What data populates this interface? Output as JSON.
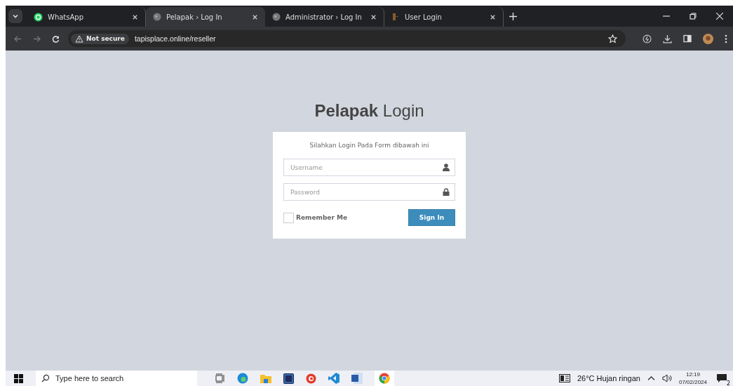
{
  "browser": {
    "tabs": [
      {
        "title": "WhatsApp",
        "kind": "whatsapp",
        "selected": false
      },
      {
        "title": "Pelapak › Log In",
        "kind": "globe",
        "selected": true
      },
      {
        "title": "Administrator › Log In",
        "kind": "globe",
        "selected": false
      },
      {
        "title": "User Login",
        "kind": "book",
        "selected": false
      }
    ],
    "security": "Not secure",
    "url": "tapisplace.online/reseller"
  },
  "page": {
    "title": "**Pelapak** Login",
    "subtitle": "Silahkan Login Pada Form dibawah ini",
    "fields": [
      {
        "placeholder": "Username",
        "kind": "user"
      },
      {
        "placeholder": "Password",
        "kind": "password"
      }
    ],
    "remember": {
      "label": "Remember Me",
      "checked": false
    },
    "submit": "Sign In"
  },
  "taskbar": {
    "search_placeholder": "Type here to search",
    "apps": [
      {
        "kind": "taskview"
      },
      {
        "kind": "edge"
      },
      {
        "kind": "explorer"
      },
      {
        "kind": "photoshop"
      },
      {
        "kind": "app"
      },
      {
        "kind": "vscode"
      },
      {
        "kind": "word"
      },
      {
        "kind": "chrome"
      }
    ],
    "weather": "26°C  Hujan ringan",
    "time": "12:19",
    "date": "07/02/2024",
    "notifications": "2"
  }
}
